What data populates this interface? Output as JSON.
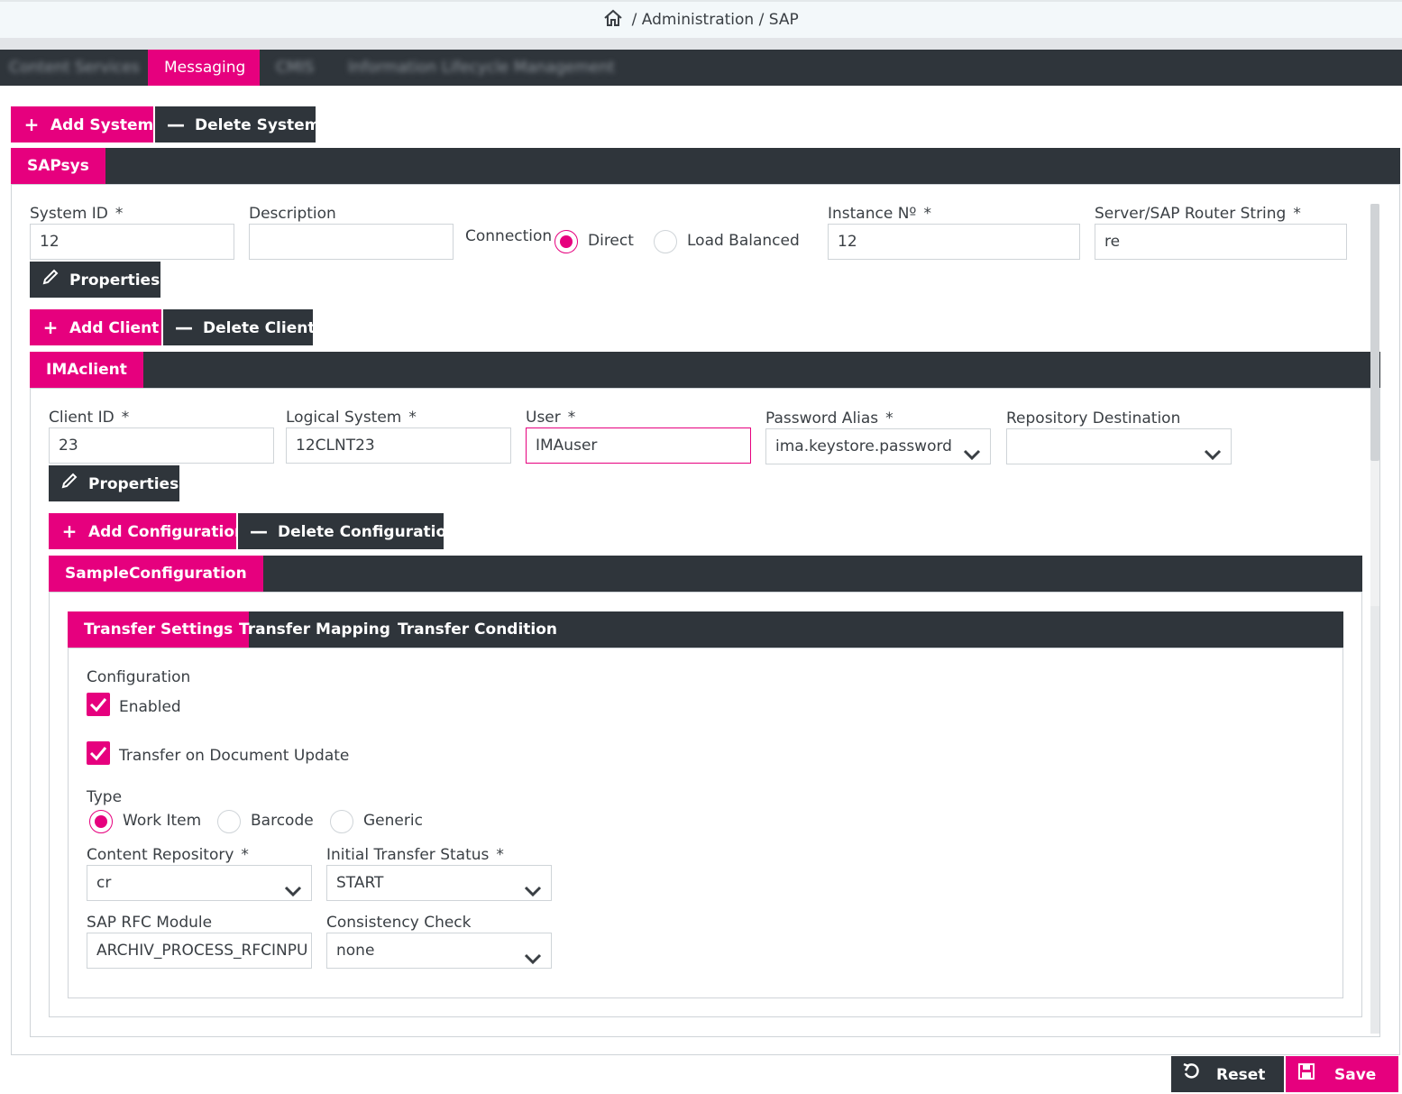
{
  "breadcrumb": {
    "separator": "/",
    "items": [
      "Administration",
      "SAP"
    ]
  },
  "tabs": [
    {
      "label": "Content Services",
      "blurred": true
    },
    {
      "label": "Messaging",
      "active": true
    },
    {
      "label": "CMIS",
      "blurred": true
    },
    {
      "label": "Information Lifecycle Management",
      "blurred": true
    }
  ],
  "system_toolbar": {
    "add": "Add System",
    "delete": "Delete System"
  },
  "system_tab": "SAPsys",
  "system": {
    "system_id_label": "System ID",
    "system_id": "12",
    "description_label": "Description",
    "description": "",
    "connection_label": "Connection",
    "direct": "Direct",
    "load_balanced": "Load Balanced",
    "instance_label": "Instance Nº",
    "instance": "12",
    "server_label": "Server/SAP Router String",
    "server": "re",
    "properties": "Properties"
  },
  "client_toolbar": {
    "add": "Add Client",
    "delete": "Delete Client"
  },
  "client_tab": "IMAclient",
  "client": {
    "client_id_label": "Client ID",
    "client_id": "23",
    "logical_label": "Logical System",
    "logical": "12CLNT23",
    "user_label": "User",
    "user": "IMAuser",
    "password_label": "Password Alias",
    "password": "ima.keystore.password",
    "repo_label": "Repository Destination",
    "repo": "",
    "properties": "Properties"
  },
  "config_toolbar": {
    "add": "Add Configuration",
    "delete": "Delete Configuration"
  },
  "config_tab": "SampleConfiguration",
  "config_subtabs": [
    "Transfer Settings",
    "Transfer Mapping",
    "Transfer Condition"
  ],
  "settings": {
    "configuration_label": "Configuration",
    "enabled": "Enabled",
    "transfer_update": "Transfer on Document Update",
    "type_label": "Type",
    "types": [
      "Work Item",
      "Barcode",
      "Generic"
    ],
    "content_repo_label": "Content Repository",
    "content_repo": "cr",
    "initial_status_label": "Initial Transfer Status",
    "initial_status": "START",
    "rfc_label": "SAP RFC Module",
    "rfc": "ARCHIV_PROCESS_RFCINPU",
    "consistency_label": "Consistency Check",
    "consistency": "none"
  },
  "required_mark": "*",
  "footer": {
    "reset": "Reset",
    "save": "Save"
  },
  "colors": {
    "accent": "#e6007e",
    "dark": "#2f353b"
  }
}
